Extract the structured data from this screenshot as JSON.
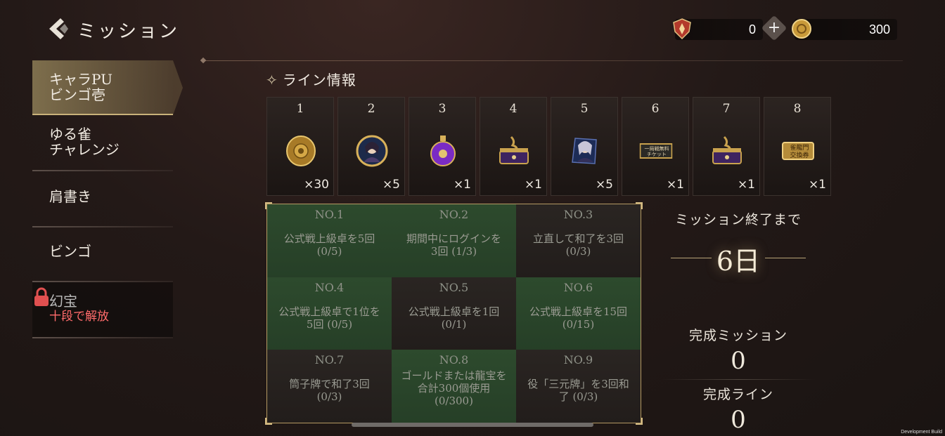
{
  "header": {
    "title": "ミッション"
  },
  "currency": [
    {
      "icon": "shield-token-icon",
      "value": "0"
    },
    {
      "icon": "gold-coin-icon",
      "value": "300"
    }
  ],
  "plus_label": "+",
  "sidebar": {
    "items": [
      {
        "line1": "キャラPU",
        "line2": "ビンゴ壱"
      },
      {
        "line1": "ゆる雀",
        "line2": "チャレンジ"
      },
      {
        "line1": "肩書き",
        "line2": ""
      },
      {
        "line1": "ビンゴ",
        "line2": ""
      },
      {
        "line1": "幻宝",
        "line2": "十段で解放"
      }
    ]
  },
  "line_info": {
    "title": "ライン情報",
    "rewards": [
      {
        "num": "1",
        "count": "×30",
        "icon": "gold-medal-icon"
      },
      {
        "num": "2",
        "count": "×5",
        "icon": "character-portrait-icon"
      },
      {
        "num": "3",
        "count": "×1",
        "icon": "purple-potion-icon"
      },
      {
        "num": "4",
        "count": "×1",
        "icon": "treasure-chest-icon"
      },
      {
        "num": "5",
        "count": "×5",
        "icon": "character-card-icon"
      },
      {
        "num": "6",
        "count": "×1",
        "icon": "ticket-icon"
      },
      {
        "num": "7",
        "count": "×1",
        "icon": "treasure-chest-icon"
      },
      {
        "num": "8",
        "count": "×1",
        "icon": "exchange-ticket-icon"
      }
    ],
    "ticket6_text": "一局戦無料\nチケット",
    "ticket8_text": "雀龍門\n交換券"
  },
  "bingo": [
    {
      "no": "NO.1",
      "text": "公式戦上級卓を5回\n(0/5)"
    },
    {
      "no": "NO.2",
      "text": "期間中にログインを\n3回 (1/3)"
    },
    {
      "no": "NO.3",
      "text": "立直して和了を3回\n(0/3)"
    },
    {
      "no": "NO.4",
      "text": "公式戦上級卓で1位を\n5回 (0/5)"
    },
    {
      "no": "NO.5",
      "text": "公式戦上級卓を1回\n(0/1)"
    },
    {
      "no": "NO.6",
      "text": "公式戦上級卓を15回\n(0/15)"
    },
    {
      "no": "NO.7",
      "text": "筒子牌で和了3回\n(0/3)"
    },
    {
      "no": "NO.8",
      "text": "ゴールドまたは龍宝を\n合計300個使用\n(0/300)"
    },
    {
      "no": "NO.9",
      "text": "役「三元牌」を3回和\n了 (0/3)"
    }
  ],
  "stats": {
    "until_end_label": "ミッション終了まで",
    "days": "6日",
    "completed_missions_label": "完成ミッション",
    "completed_missions": "0",
    "completed_lines_label": "完成ライン",
    "completed_lines": "0"
  },
  "dev_build": "Development Build",
  "colors": {
    "accent_gold": "#c9b27a",
    "cell_green": "#2d4a2d",
    "lock_red": "#e05050"
  }
}
